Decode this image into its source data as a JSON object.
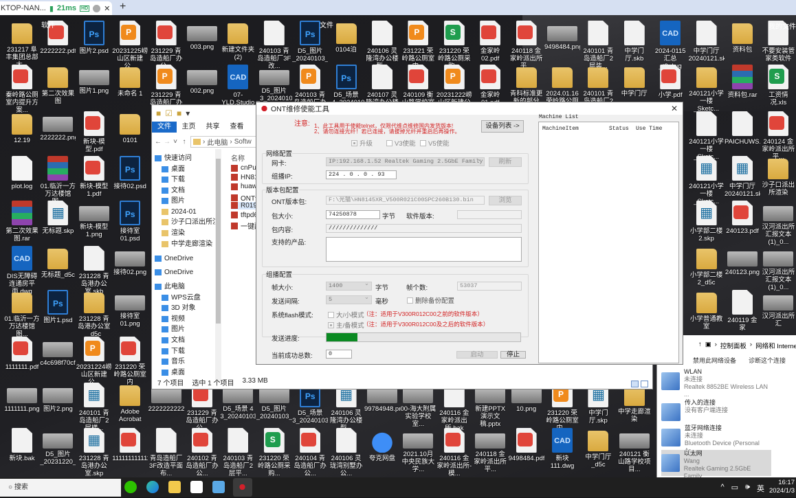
{
  "rdp": {
    "tab_title": "KTOP-NAN...",
    "latency": "21ms",
    "hd_badge": "HD",
    "close": "✕",
    "new_tab": "+",
    "signal_color": "#2aa05a"
  },
  "desktop": {
    "fences": [
      "软件",
      "文件",
      "我的文件"
    ],
    "rows": [
      [
        {
          "l": "231217 阜丰集团总部大...",
          "t": "folder"
        },
        {
          "l": "2222222.pdf",
          "t": "pdf"
        },
        {
          "l": "图片2.psd",
          "t": "psd"
        },
        {
          "l": "20231225崂山区新建公...",
          "t": "wpsp"
        },
        {
          "l": "231229 青岛造船厂办公...",
          "t": "pdf"
        },
        {
          "l": "003.png",
          "t": "png"
        },
        {
          "l": "新建文件夹(2)",
          "t": "folder"
        },
        {
          "l": "240103 青岛造船厂3F改...",
          "t": "blank"
        },
        {
          "l": "D5_图片_20240103_160...",
          "t": "psd"
        },
        {
          "l": "0104泊",
          "t": "folder"
        },
        {
          "l": "240106 灵隆湾办公楼型...",
          "t": "blank"
        },
        {
          "l": "231221 荣岭路公厕室内...",
          "t": "wpsp"
        },
        {
          "l": "231220 荣岭路公厕采购...",
          "t": "wpss"
        },
        {
          "l": "金家岭02.pdf",
          "t": "pdf"
        },
        {
          "l": "240118 金家岭派出所平...",
          "t": "pdf"
        },
        {
          "l": "9498484.png",
          "t": "png"
        },
        {
          "l": "240101 青岛造船厂2层装...",
          "t": "blank"
        },
        {
          "l": "中学门厅.skb",
          "t": "blank"
        },
        {
          "l": "2024-0115汇总_t3.dwg",
          "t": "cad"
        },
        {
          "l": "中学门厅20240121.skb",
          "t": "blank"
        },
        {
          "l": "资料包",
          "t": "folder"
        },
        {
          "l": "不要安装管家类软件",
          "t": "blank"
        }
      ],
      [
        {
          "l": "秦岭路公厕室内提升方案...",
          "t": "pdf"
        },
        {
          "l": "第二次效果图",
          "t": "folder"
        },
        {
          "l": "图片1.png",
          "t": "png"
        },
        {
          "l": "未命名 1",
          "t": "folder"
        },
        {
          "l": "231229 青岛造船厂办公...",
          "t": "wpsp"
        },
        {
          "l": "002.png",
          "t": "png"
        },
        {
          "l": "07-YLD.Studio 设计图库...",
          "t": "cad"
        },
        {
          "l": "D5_图片_3_20240103_1...",
          "t": "png"
        },
        {
          "l": "240103 青岛造船厂办公",
          "t": "wpsp"
        },
        {
          "l": "D5_场景_4_20240103_2",
          "t": "psd"
        },
        {
          "l": "240107 灵隆湾办公楼型",
          "t": "blank"
        },
        {
          "l": "240109 衡山路学校室内",
          "t": "pdf"
        },
        {
          "l": "20231222崂山区新建公",
          "t": "wpsp"
        },
        {
          "l": "金家岭01.pdf",
          "t": "pdf"
        },
        {
          "l": "青科标准更新的部分",
          "t": "folder"
        },
        {
          "l": "2024.01.16 荣岭路公厕",
          "t": "folder"
        },
        {
          "l": "240101 青岛造船厂2层",
          "t": "folder"
        },
        {
          "l": "中学门厅",
          "t": "folder"
        },
        {
          "l": "小学.pdf",
          "t": "pdf"
        },
        {
          "l": "240121小学一楼_Sketc...",
          "t": "folder"
        },
        {
          "l": "资料包.rar",
          "t": "rar"
        },
        {
          "l": "工资情况.xls",
          "t": "wpss"
        }
      ],
      [
        {
          "l": "12.19",
          "t": "folder"
        },
        {
          "l": "2222222.png",
          "t": "png"
        },
        {
          "l": "新块-模型.pdf",
          "t": "pdf"
        },
        {
          "l": "0101",
          "t": "folder"
        },
        null,
        null,
        null,
        null,
        null,
        null,
        null,
        null,
        null,
        null,
        null,
        null,
        null,
        null,
        null,
        {
          "l": "240121小学一楼_Sketc...",
          "t": "blank"
        },
        {
          "l": "PAICHUWS.skb",
          "t": "blank"
        },
        {
          "l": "240124 金家岭派出所平...",
          "t": "pdf"
        }
      ],
      [
        {
          "l": "plot.log",
          "t": "log"
        },
        {
          "l": "01.临沂一方万达楼馆图...",
          "t": "rar"
        },
        {
          "l": "新块-模型1.pdf",
          "t": "pdf"
        },
        {
          "l": "接待02.psd",
          "t": "psd"
        },
        null,
        null,
        null,
        null,
        null,
        null,
        null,
        null,
        null,
        null,
        null,
        null,
        null,
        null,
        null,
        {
          "l": "240121小学一楼_Sketc...",
          "t": "skp"
        },
        {
          "l": "中学门厅20240121.skp",
          "t": "skp"
        },
        {
          "l": "沙子口派出所渲染",
          "t": "folder"
        }
      ],
      [
        {
          "l": "第二次效果图.rar",
          "t": "rar"
        },
        {
          "l": "无标题.skp",
          "t": "skp"
        },
        {
          "l": "新块-模型1.png",
          "t": "png"
        },
        {
          "l": "接待室01.psd",
          "t": "psd"
        },
        null,
        null,
        null,
        null,
        null,
        null,
        null,
        null,
        null,
        null,
        null,
        null,
        null,
        null,
        null,
        {
          "l": "小学部二楼2.skp",
          "t": "skp"
        },
        {
          "l": "240123.pdf",
          "t": "pdf"
        },
        {
          "l": "汉河派出所汇报文本(1)_0...",
          "t": "png"
        }
      ],
      [
        {
          "l": "DIS无障碍连通房平面.dwg",
          "t": "cad"
        },
        {
          "l": "无标题_d5c",
          "t": "folder"
        },
        {
          "l": "231228 青岛港办公室.skb",
          "t": "blank"
        },
        {
          "l": "接待02.png",
          "t": "png"
        },
        null,
        null,
        null,
        null,
        null,
        null,
        null,
        null,
        null,
        null,
        null,
        null,
        null,
        null,
        null,
        {
          "l": "小学部二楼2_d5c",
          "t": "folder"
        },
        {
          "l": "240123.png",
          "t": "png"
        },
        {
          "l": "汉河派出所汇报文本(1)_0...",
          "t": "png"
        }
      ],
      [
        {
          "l": "01.临沂一方万达楼馆图...",
          "t": "folder"
        },
        {
          "l": "图片1.psd",
          "t": "psd"
        },
        {
          "l": "231228 青岛港办公室_d5c",
          "t": "folder"
        },
        {
          "l": "接待室01.png",
          "t": "png"
        },
        null,
        null,
        null,
        null,
        null,
        null,
        null,
        null,
        null,
        null,
        null,
        null,
        null,
        null,
        null,
        {
          "l": "小学普通教室",
          "t": "folder"
        },
        {
          "l": "240119 金家",
          "t": "blank"
        },
        {
          "l": "汉河派出所汇",
          "t": "png"
        }
      ],
      [
        {
          "l": "1111111.pdf",
          "t": "pdf"
        },
        {
          "l": "c4c698f70cf83536161a...",
          "t": "png"
        },
        {
          "l": "20231224崂山区新建公...",
          "t": "wpsp"
        },
        {
          "l": "231220 荣岭路公厕室内",
          "t": "pdf"
        }
      ],
      [
        {
          "l": "1111111.png",
          "t": "png"
        },
        {
          "l": "图片2.png",
          "t": "png"
        },
        {
          "l": "240101 青岛造船厂2层楼...",
          "t": "skp"
        },
        {
          "l": "Adobe Acrobat",
          "t": "folder"
        },
        {
          "l": "2222222222222.png",
          "t": "png"
        },
        {
          "l": "231229 青岛造船厂办公...",
          "t": "pdf"
        },
        {
          "l": "D5_场景 4 3_20240103_...",
          "t": "png"
        },
        {
          "l": "D5_图片_20240103_160...",
          "t": "png"
        },
        {
          "l": "D5_场景 3_20240103_2...",
          "t": "psd"
        },
        {
          "l": "240106 灵隆湾办公楼型...",
          "t": "skp"
        },
        {
          "l": "99784948.png",
          "t": "png"
        },
        {
          "l": "00-海大附属实验学校室...",
          "t": "png"
        },
        {
          "l": "240116 金家岭派出所.bak",
          "t": "blank"
        },
        {
          "l": "新建PPTX 演示文稿.pptx",
          "t": "png"
        },
        {
          "l": "10.png",
          "t": "png"
        },
        {
          "l": "231220 荣岭路公厕室内...",
          "t": "wpsp"
        },
        {
          "l": "中学门厅.skp",
          "t": "skp"
        },
        {
          "l": "中学走廊渲染",
          "t": "folder"
        }
      ],
      [
        {
          "l": "新块.bak",
          "t": "blank"
        },
        {
          "l": "D5_图片_20231220_121...",
          "t": "png"
        },
        {
          "l": "231228 青岛港办公室.skp",
          "t": "skp"
        },
        {
          "l": "1111111111111.pdf",
          "t": "pdf"
        },
        {
          "l": "青岛造船厂3F改造平面布...",
          "t": "blank"
        },
        {
          "l": "240102 青岛造船厂办公...",
          "t": "pdf"
        },
        {
          "l": "240103 青岛造船厂2层平...",
          "t": "blank"
        },
        {
          "l": "231220 荣岭路公厕采购...",
          "t": "wpss"
        },
        {
          "l": "240104 青岛造船厂办公...",
          "t": "pdf"
        },
        {
          "l": "240106 灵珑湾别墅办公...",
          "t": "blank"
        },
        {
          "l": "夸克网盘",
          "t": "cloud"
        },
        {
          "l": "2021.10月中央民族大学...",
          "t": "png"
        },
        {
          "l": "240116 金家岭派出所-模...",
          "t": "pdf"
        },
        {
          "l": "240118 金家岭派出所平...",
          "t": "png"
        },
        {
          "l": "9498484.pdf",
          "t": "pdf"
        },
        {
          "l": "新块111.dwg",
          "t": "cad"
        },
        {
          "l": "中学门厅_d5c",
          "t": "folder"
        },
        {
          "l": "240121 衡山路学校项目...",
          "t": "png"
        }
      ]
    ]
  },
  "explorer": {
    "ribbon": [
      "文件",
      "主页",
      "共享",
      "查看",
      "应"
    ],
    "path": [
      "此电脑",
      "Softw"
    ],
    "nav": [
      {
        "l": "快速访问",
        "k": "top"
      },
      {
        "l": "桌面"
      },
      {
        "l": "下载"
      },
      {
        "l": "文档"
      },
      {
        "l": "图片"
      },
      {
        "l": "2024-01",
        "k": "fold"
      },
      {
        "l": "沙子口派出所渲",
        "k": "fold"
      },
      {
        "l": "渲染",
        "k": "fold"
      },
      {
        "l": "中学走廊渲染",
        "k": "fold"
      },
      {
        "l": "OneDrive",
        "k": "top"
      },
      {
        "l": "OneDrive",
        "k": "top"
      },
      {
        "l": "此电脑",
        "k": "top"
      },
      {
        "l": "WPS云盘"
      },
      {
        "l": "3D 对象"
      },
      {
        "l": "视频"
      },
      {
        "l": "图片"
      },
      {
        "l": "文档"
      },
      {
        "l": "下载"
      },
      {
        "l": "音乐"
      },
      {
        "l": "桌面"
      }
    ],
    "column_name": "名称",
    "files": [
      "cnPuTTY",
      "HN8145",
      "huawei",
      "ONT使能",
      "R019C0",
      "tftpd64",
      "一键配"
    ],
    "selected_index": 4,
    "status": {
      "count": "7 个项目",
      "selected": "选中 1 个项目",
      "size": "3.33 MB"
    }
  },
  "ont": {
    "title": "ONT维修使能工具",
    "notice_label": "注意:",
    "notice_1": "1、此工具用于使能telnet，仅限代维点维修国内发货版本!",
    "notice_2": "2、请勿连接光纤！若已连接，请拔掉光纤并重启后再操作。",
    "device_list_button": "设备列表 ->",
    "modes": [
      {
        "label": "升级",
        "checked": true
      },
      {
        "label": "V3使能",
        "checked": false
      },
      {
        "label": "V5使能",
        "checked": false
      }
    ],
    "net_group": "网络配置",
    "nic_label": "网卡:",
    "nic_value": "IP:192.168.1.52 Realtek Gaming 2.5GbE Family Controller",
    "refresh_button": "刷新",
    "mcast_label": "组播IP:",
    "mcast_ip": "224  .  0  .  0  .  93",
    "pkg_group": "版本包配置",
    "pkg_label": "ONT版本包:",
    "pkg_path": "F:\\光猫\\HN8145XR_V500R021C00SPC260B130.bin",
    "browse_button": "浏览",
    "size_label": "包大小:",
    "size_value": "74250878",
    "bytes_unit": "字节",
    "sw_version_label": "软件版本:",
    "sw_version_value": "",
    "content_label": "包内容:",
    "content_value": "//////////////",
    "products_label": "支持的产品:",
    "products_value": "",
    "mc_group": "组播配置",
    "frame_size_label": "帧大小:",
    "frame_size_value": "1400",
    "frame_count_label": "帧个数:",
    "frame_count_value": "53037",
    "interval_label": "发送间隔:",
    "interval_value": "5",
    "ms_unit": "毫秒",
    "delete_backup_label": "删除备份配置",
    "flash_label": "系统flash模式:",
    "flash_opt1": "大/小模式",
    "flash_note1": "（注：适用于V300R012C00之前的软件版本）",
    "flash_opt2": "主/备模式",
    "flash_note2": "（注：适用于V300R012C00及之后的软件版本）",
    "progress_label": "发送进度:",
    "progress_percent": 16,
    "progress_color": "#0b8a22",
    "success_label": "当前成功总数:",
    "success_value": "0",
    "start_button": "启动",
    "stop_button": "停止",
    "machine_list": {
      "title": "Machine List",
      "columns": [
        "MachineItem",
        "Status",
        "Use Time"
      ]
    }
  },
  "network": {
    "breadcrumb": [
      "控制面板",
      "网络和 Internet"
    ],
    "toolbar": [
      "禁用此网络设备",
      "诊断这个连接",
      "重命"
    ],
    "items": [
      {
        "name": "WLAN",
        "status": "未连接",
        "device": "Realtek 8852BE Wireless LAN ..."
      },
      {
        "name": "传入的连接",
        "status": "没有客户端连接",
        "device": ""
      },
      {
        "name": "蓝牙网络连接",
        "status": "未连接",
        "device": "Bluetooth Device (Personal Ar..."
      },
      {
        "name": "以太网",
        "status": "Wang",
        "device": "Realtek Gaming 2.5GbE Family...",
        "selected": true
      }
    ]
  },
  "taskbar": {
    "search_placeholder": "搜索",
    "apps": [
      "wechat",
      "edge",
      "file-explorer",
      "tencent-docs",
      "remote-desktop",
      "huawei-tool"
    ],
    "tray_chevron": "^",
    "ime": "英",
    "time": "16:17",
    "date": "2024/1/3"
  }
}
